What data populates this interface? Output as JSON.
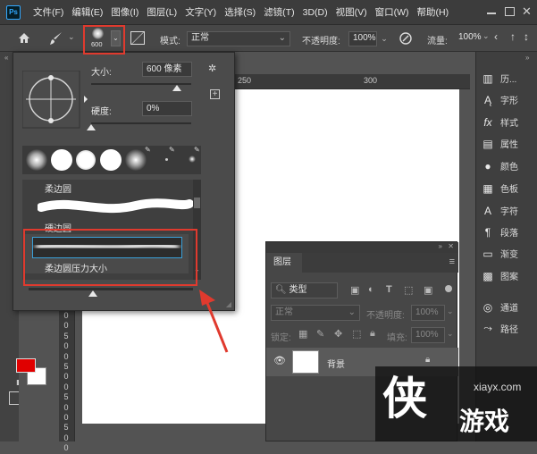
{
  "menu": {
    "items": [
      "文件(F)",
      "编辑(E)",
      "图像(I)",
      "图层(L)",
      "文字(Y)",
      "选择(S)",
      "滤镜(T)",
      "3D(D)",
      "视图(V)",
      "窗口(W)",
      "帮助(H)"
    ]
  },
  "options": {
    "brush_size_badge": "600",
    "mode_label": "模式:",
    "mode_value": "正常",
    "opacity_label": "不透明度:",
    "opacity_value": "100%",
    "flow_label": "流量:",
    "flow_value": "100%"
  },
  "brush_panel": {
    "size_label": "大小:",
    "size_value": "600 像素",
    "hardness_label": "硬度:",
    "hardness_value": "0%",
    "size_fraction": 0.86,
    "hardness_fraction": 0.0,
    "groups": [
      "柔边圆",
      "硬边圆",
      "柔边圆压力大小"
    ]
  },
  "layers_panel": {
    "tab": "图层",
    "filter_kind": "类型",
    "blend_mode": "正常",
    "opacity_label": "不透明度:",
    "opacity_value": "100%",
    "lock_label": "锁定:",
    "fill_label": "填充:",
    "fill_value": "100%",
    "layer_name": "背景"
  },
  "right_dock": {
    "items": [
      "历...",
      "字形",
      "样式",
      "属性",
      "颜色",
      "色板",
      "字符",
      "段落",
      "渐变",
      "图案",
      "通道",
      "路径"
    ]
  },
  "ruler_h": [
    "250",
    "300"
  ],
  "ruler_v": [
    "0",
    "0",
    "5",
    "0",
    "0",
    "5",
    "0",
    "0",
    "5",
    "0",
    "0",
    "5",
    "0",
    "0"
  ],
  "watermark": {
    "domain": "xiayx.com",
    "brand": "游戏",
    "glyph": "侠"
  },
  "colors": {
    "fg": "#e00000",
    "bg": "#ffffff",
    "annotation": "#e03a2e"
  }
}
